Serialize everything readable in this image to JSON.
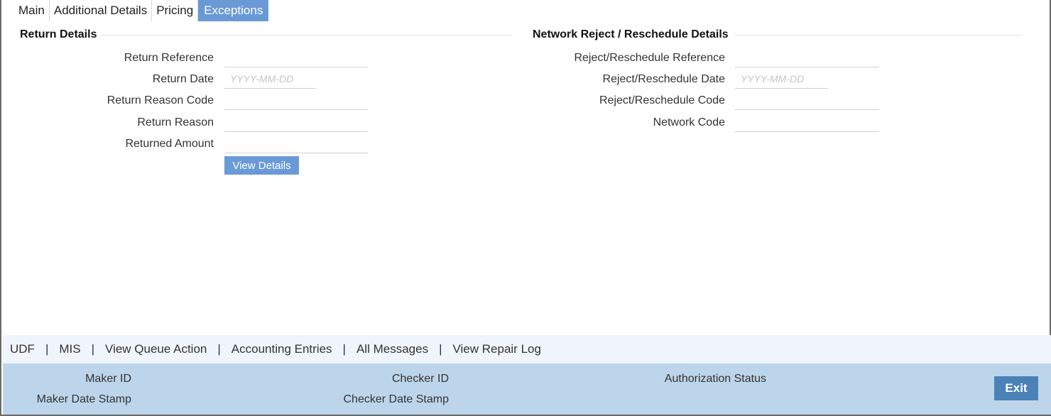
{
  "tabs": [
    {
      "label": "Main",
      "active": false
    },
    {
      "label": "Additional Details",
      "active": false
    },
    {
      "label": "Pricing",
      "active": false
    },
    {
      "label": "Exceptions",
      "active": true
    }
  ],
  "return_details": {
    "title": "Return Details",
    "return_reference": {
      "label": "Return Reference",
      "value": ""
    },
    "return_date": {
      "label": "Return Date",
      "value": "",
      "placeholder": "YYYY-MM-DD"
    },
    "return_reason_code": {
      "label": "Return Reason Code",
      "value": ""
    },
    "return_reason": {
      "label": "Return Reason",
      "value": ""
    },
    "returned_amount": {
      "label": "Returned Amount",
      "value": ""
    },
    "view_details_label": "View Details"
  },
  "network_reject": {
    "title": "Network Reject / Reschedule Details",
    "reference": {
      "label": "Reject/Reschedule Reference",
      "value": ""
    },
    "date": {
      "label": "Reject/Reschedule Date",
      "value": "",
      "placeholder": "YYYY-MM-DD"
    },
    "code": {
      "label": "Reject/Reschedule Code",
      "value": ""
    },
    "network_code": {
      "label": "Network Code",
      "value": ""
    }
  },
  "links": [
    "UDF",
    "MIS",
    "View Queue Action",
    "Accounting Entries",
    "All Messages",
    "View Repair Log"
  ],
  "footer": {
    "maker_id": "Maker ID",
    "maker_date_stamp": "Maker Date Stamp",
    "checker_id": "Checker ID",
    "checker_date_stamp": "Checker Date Stamp",
    "authorization_status": "Authorization Status",
    "exit_label": "Exit"
  },
  "colors": {
    "tab_active": "#6a9ad6",
    "linkbar_bg": "#f0f5fb",
    "footer_bg": "#bdd5ea",
    "exit_button": "#4a82b8"
  }
}
